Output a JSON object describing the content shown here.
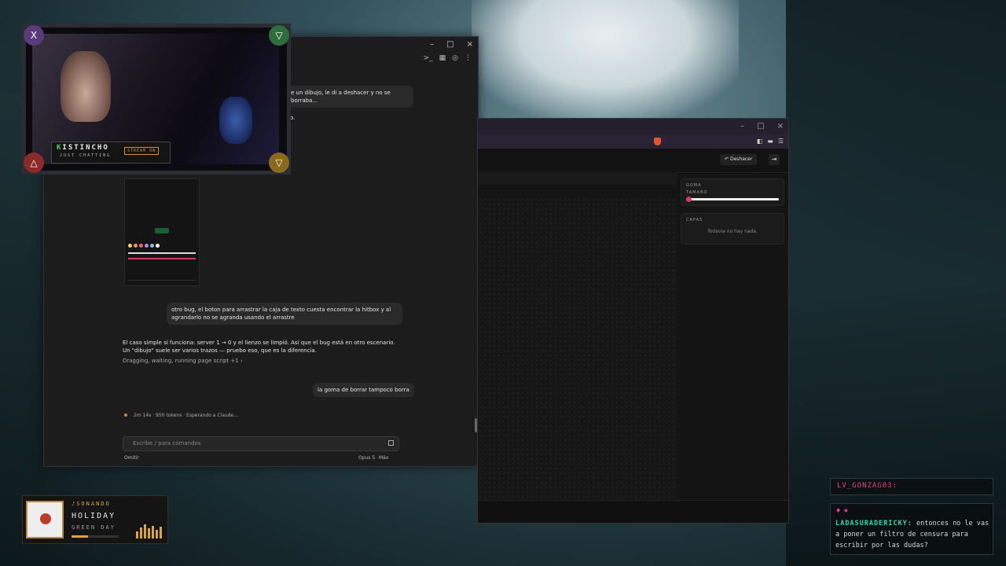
{
  "chat_window": {
    "title_controls": [
      "–",
      "□",
      "×"
    ],
    "tools": [
      ">_",
      "▦",
      "◎",
      "⋮"
    ],
    "messages": [
      {
        "text": "e un dibujo, le di a deshacer y no se borraba...",
        "type": "user"
      },
      {
        "text": "o.",
        "type": "assistant"
      },
      {
        "text": "otro bug, el boton para arrastrar la caja de texto cuesta encontrar la hitbox y al agrandarlo no se agranda usando el arrastre",
        "type": "user"
      },
      {
        "text": "El caso simple sí funciona: server 1 → 0 y el lienzo se limpió. Así que el bug está en otro escenario. Un \"dibujo\" suele ser varios trazos — pruebo eso, que es la diferencia.",
        "type": "assistant"
      },
      {
        "text": "Dragging, waiting, running page script +1 ›",
        "type": "activity"
      },
      {
        "text": "la goma de borrar tampoco borra",
        "type": "user"
      }
    ],
    "status": "2m 14s · 950 tokens · Esperando a Claude...",
    "input_placeholder": "Escribe / para comandos",
    "bottom_left": "Omitir",
    "model": "Opus 5",
    "effort": "Máx"
  },
  "draw_window": {
    "title_controls": [
      "–",
      "□",
      "×"
    ],
    "extensions": [
      "◧",
      "▬",
      "☰"
    ],
    "undo_label": "Deshacer",
    "undo_icon": "↶",
    "exit_icon": "⇥",
    "panel": {
      "tool_title": "GOMA",
      "size_label": "TAMAÑO",
      "size_value": 0.02,
      "layers_title": "CAPAS",
      "layers_empty": "Todavía no hay nada."
    }
  },
  "webcam": {
    "name_first": "K",
    "name_rest": "ISTINCHO",
    "category": "JUST CHATTING",
    "badge": "STREAM ON",
    "corner_icons": [
      "X",
      "▽",
      "△",
      "▽"
    ]
  },
  "now_playing": {
    "label": "♪SONANDO",
    "song": "HOLIDAY",
    "artist": "GREEN DAY",
    "progress": 0.35,
    "eq_levels": [
      0.5,
      0.8,
      1.0,
      0.7,
      0.9,
      0.6,
      0.85
    ]
  },
  "stream_chat": [
    {
      "user": "LV_GONZAG03:",
      "text": ""
    },
    {
      "user": "LADASURADERICKY:",
      "text": " entonces no le vas a poner un filtro de censura para escribir por las dudas?",
      "icons": "♦ ★"
    }
  ],
  "colors": {
    "accent_pink": "#d23c65",
    "stream_green": "#4bd36b",
    "music_gold": "#d9a54a",
    "chat_teal": "#3bd6b0"
  }
}
